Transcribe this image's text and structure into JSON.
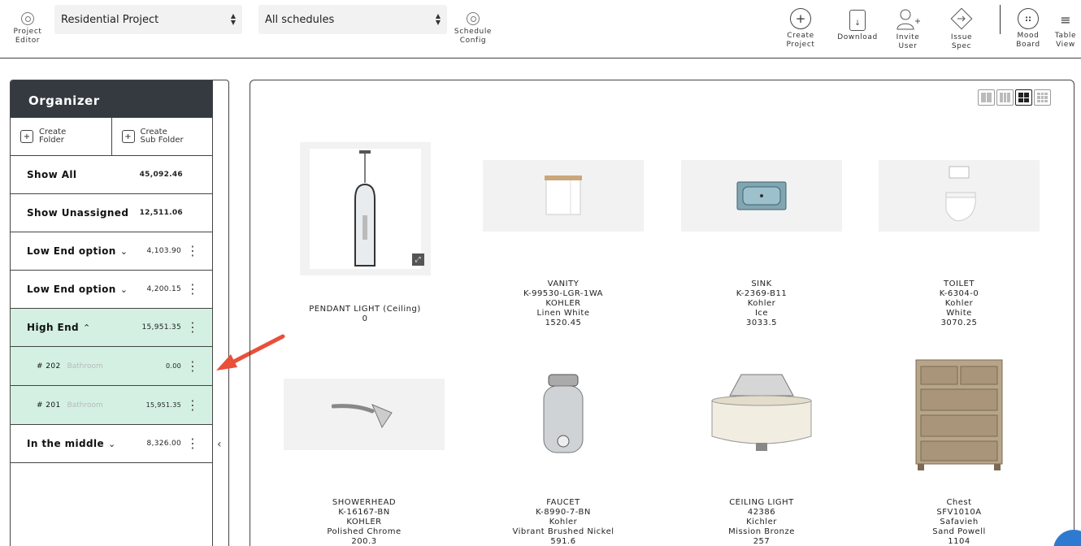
{
  "toolbar": {
    "project_editor_label": "Project\nEditor",
    "project_select_value": "Residential Project",
    "schedule_select_value": "All schedules",
    "schedule_config_label": "Schedule\nConfig",
    "create_project_label": "Create\nProject",
    "download_label": "Download",
    "invite_user_label": "Invite\nUser",
    "issue_spec_label": "Issue\nSpec",
    "mood_board_label": "Mood\nBoard",
    "table_view_label": "Table\nView",
    "create_project_glyph": "+",
    "download_glyph": "↓",
    "table_view_glyph": "≡"
  },
  "organizer": {
    "title": "Organizer",
    "create_folder_label": "Create\nFolder",
    "create_subfolder_label": "Create\nSub Folder",
    "rows": [
      {
        "name": "Show All",
        "amount": "45,092.46"
      },
      {
        "name": "Show Unassigned",
        "amount": "12,511.06"
      },
      {
        "name": "Low End option",
        "amount": "4,103.90",
        "chevron": "⌄"
      },
      {
        "name": "Low End option",
        "amount": "4,200.15",
        "chevron": "⌄"
      },
      {
        "name": "High End",
        "amount": "15,951.35",
        "chevron": "⌃"
      },
      {
        "name": "# 202",
        "room": "Bathroom",
        "amount": "0.00"
      },
      {
        "name": "# 201",
        "room": "Bathroom",
        "amount": "15,951.35"
      },
      {
        "name": "In the middle",
        "amount": "8,326.00",
        "chevron": "⌄"
      }
    ],
    "collapse_glyph": "‹"
  },
  "products": [
    {
      "lines": [
        "PENDANT LIGHT (Ceiling)",
        "0"
      ],
      "icon": "pendant-light"
    },
    {
      "lines": [
        "VANITY",
        "K-99530-LGR-1WA",
        "KOHLER",
        "Linen White",
        "1520.45"
      ],
      "icon": "vanity"
    },
    {
      "lines": [
        "SINK",
        "K-2369-B11",
        "Kohler",
        "Ice",
        "3033.5"
      ],
      "icon": "sink"
    },
    {
      "lines": [
        "TOILET",
        "K-6304-0",
        "Kohler",
        "White",
        "3070.25"
      ],
      "icon": "toilet"
    },
    {
      "lines": [
        "SHOWERHEAD",
        "K-16167-BN",
        "KOHLER",
        "Polished Chrome",
        "200.3"
      ],
      "icon": "showerhead"
    },
    {
      "lines": [
        "FAUCET",
        "K-8990-7-BN",
        "Kohler",
        "Vibrant Brushed Nickel",
        "591.6"
      ],
      "icon": "faucet"
    },
    {
      "lines": [
        "CEILING LIGHT",
        "42386",
        "Kichler",
        "Mission Bronze",
        "257"
      ],
      "icon": "ceiling-light"
    },
    {
      "lines": [
        "Chest",
        "SFV1010A",
        "Safavieh",
        "Sand Powell",
        "1104"
      ],
      "icon": "chest"
    }
  ],
  "colors": {
    "organizer_header": "#343a40",
    "active_row": "#d4f0e3",
    "annotation_arrow": "#e8503a"
  }
}
